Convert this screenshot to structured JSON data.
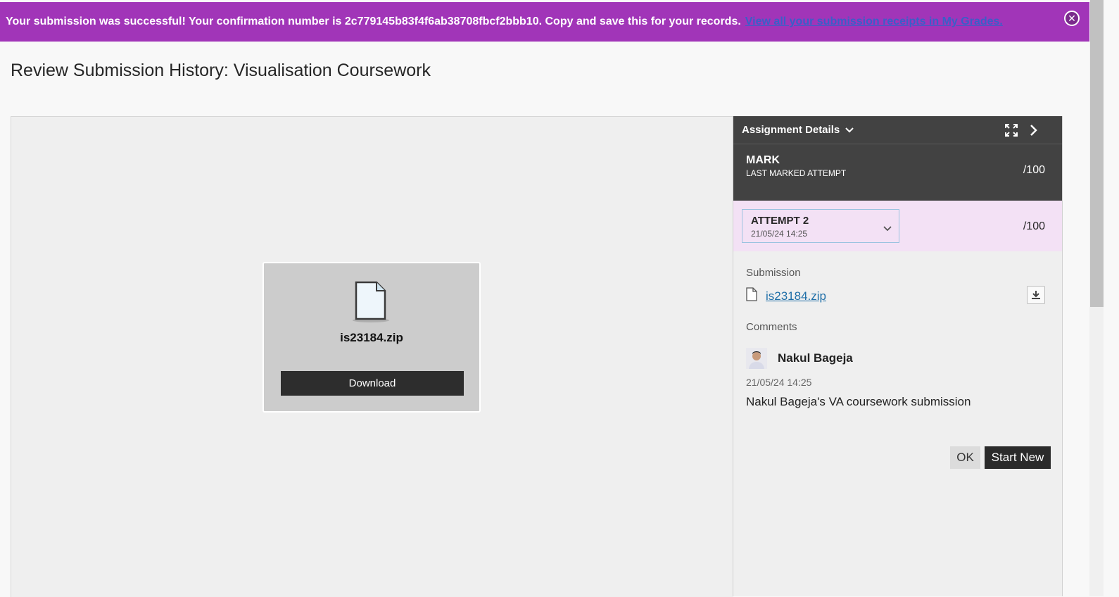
{
  "banner": {
    "message": "Your submission was successful! Your confirmation number is 2c779145b83f4f6ab38708fbcf2bbb10. Copy and save this for your records.",
    "link_text": "View all your submission receipts in My Grades.",
    "close_icon": "close-circle-icon",
    "background": "#a135b8"
  },
  "page": {
    "title": "Review Submission History: Visualisation Coursework"
  },
  "viewer": {
    "file_name": "is23184.zip",
    "download_label": "Download",
    "file_icon": "document-icon"
  },
  "panel": {
    "header_title": "Assignment Details",
    "header_icons": [
      "chevron-down-icon",
      "expand-icon",
      "chevron-right-icon"
    ],
    "mark": {
      "label": "MARK",
      "sublabel": "LAST MARKED ATTEMPT",
      "score": "/100"
    },
    "attempt": {
      "label": "ATTEMPT 2",
      "date": "21/05/24 14:25",
      "score": "/100",
      "background": "#f3e1f5"
    },
    "submission": {
      "label": "Submission",
      "file_name": "is23184.zip"
    },
    "comments": {
      "label": "Comments",
      "author": "Nakul Bageja",
      "date": "21/05/24 14:25",
      "text": "Nakul Bageja's VA coursework submission"
    },
    "buttons": {
      "ok": "OK",
      "start_new": "Start New"
    }
  }
}
